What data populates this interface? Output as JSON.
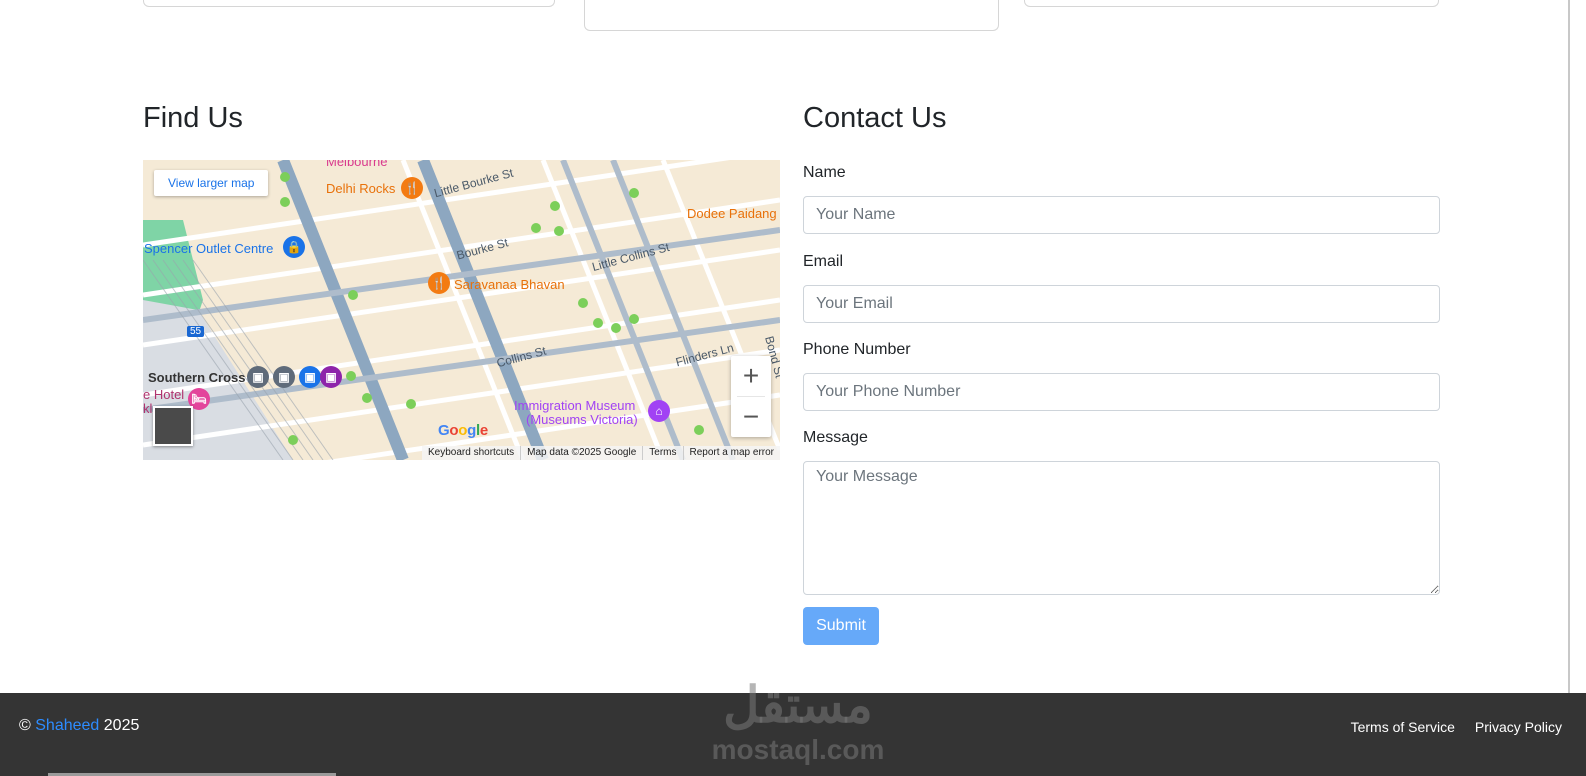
{
  "find_us": {
    "title": "Find Us",
    "map": {
      "view_larger": "View larger map",
      "zoom_in": "+",
      "zoom_out": "−",
      "google": "Google",
      "attribution": [
        "Keyboard shortcuts",
        "Map data ©2025 Google",
        "Terms",
        "Report a map error"
      ],
      "labels": {
        "melbourne": "Melbourne",
        "delhi_rocks": "Delhi Rocks",
        "little_bourke": "Little Bourke St",
        "dodee": "Dodee Paidang",
        "spencer": "Spencer Outlet Centre",
        "bourke": "Bourke St",
        "little_collins": "Little Collins St",
        "saravanaa": "Saravanaa Bhavan",
        "route_55": "55",
        "southern_cross": "Southern Cross",
        "collins": "Collins St",
        "flinders": "Flinders Ln",
        "bond": "Bond St",
        "hotel_1": "e Hotel",
        "hotel_2": "kl",
        "museum_1": "Immigration Museum",
        "museum_2": "(Museums Victoria)"
      }
    }
  },
  "contact": {
    "title": "Contact Us",
    "name_label": "Name",
    "name_placeholder": "Your Name",
    "email_label": "Email",
    "email_placeholder": "Your Email",
    "phone_label": "Phone Number",
    "phone_placeholder": "Your Phone Number",
    "message_label": "Message",
    "message_placeholder": "Your Message",
    "submit": "Submit"
  },
  "footer": {
    "copyright_symbol": "©",
    "brand": "Shaheed",
    "year": "2025",
    "links": [
      "Terms of Service",
      "Privacy Policy"
    ],
    "watermark_ar": "مستقل",
    "watermark_en": "mostaql.com"
  },
  "colors": {
    "link_blue": "#2d8cff",
    "submit_bg": "#66a9f9",
    "footer_bg": "#343434"
  }
}
